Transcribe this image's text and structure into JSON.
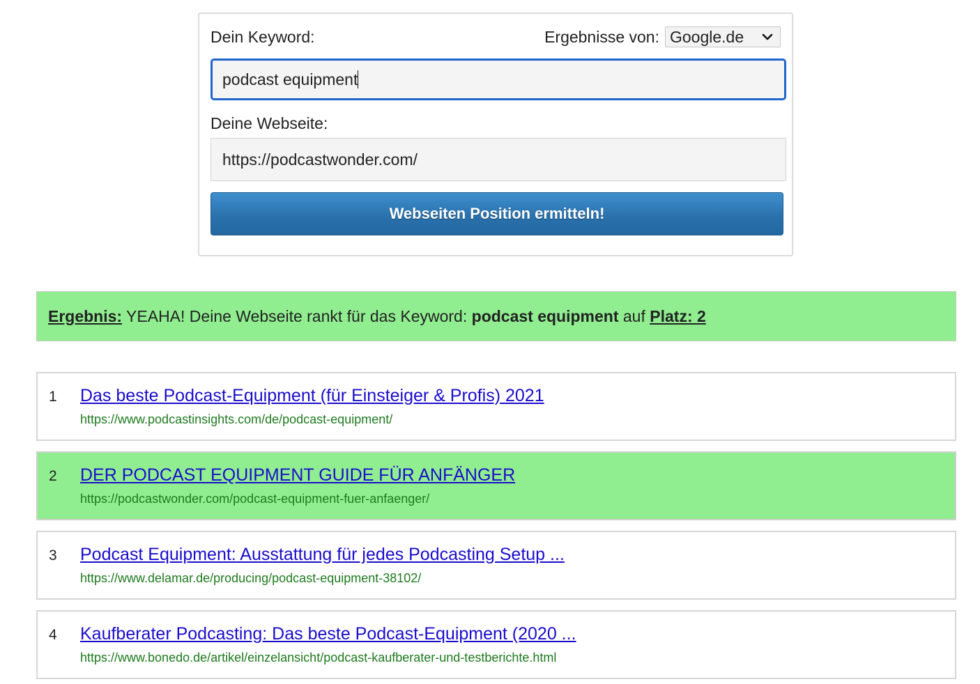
{
  "form": {
    "keyword_label": "Dein Keyword:",
    "engine_label": "Ergebnisse von:",
    "engine_selected": "Google.de",
    "keyword_value": "podcast equipment",
    "website_label": "Deine Webseite:",
    "website_value": "https://podcastwonder.com/",
    "submit_label": "Webseiten Position ermitteln!"
  },
  "result": {
    "label": "Ergebnis:",
    "message": " YEAHA! Deine Webseite rankt für das Keyword: ",
    "keyword": "podcast equipment",
    "connector": " auf ",
    "position": "Platz: 2"
  },
  "serp": [
    {
      "rank": "1",
      "title": "Das beste Podcast-Equipment (für Einsteiger & Profis) 2021",
      "url": "https://www.podcastinsights.com/de/podcast-equipment/"
    },
    {
      "rank": "2",
      "title": "DER PODCAST EQUIPMENT GUIDE FÜR ANFÄNGER",
      "url": "https://podcastwonder.com/podcast-equipment-fuer-anfaenger/"
    },
    {
      "rank": "3",
      "title": "Podcast Equipment: Ausstattung für jedes Podcasting Setup ...",
      "url": "https://www.delamar.de/producing/podcast-equipment-38102/"
    },
    {
      "rank": "4",
      "title": "Kaufberater Podcasting: Das beste Podcast-Equipment (2020 ...",
      "url": "https://www.bonedo.de/artikel/einzelansicht/podcast-kaufberater-und-testberichte.html"
    }
  ],
  "colors": {
    "highlight": "#90ee90",
    "link": "#1a0dcc",
    "url": "#1f7a1f",
    "focus_border": "#1f66cc",
    "button": "#2a72ad"
  },
  "icons": {
    "engine_dropdown": "chevron-down-icon"
  }
}
